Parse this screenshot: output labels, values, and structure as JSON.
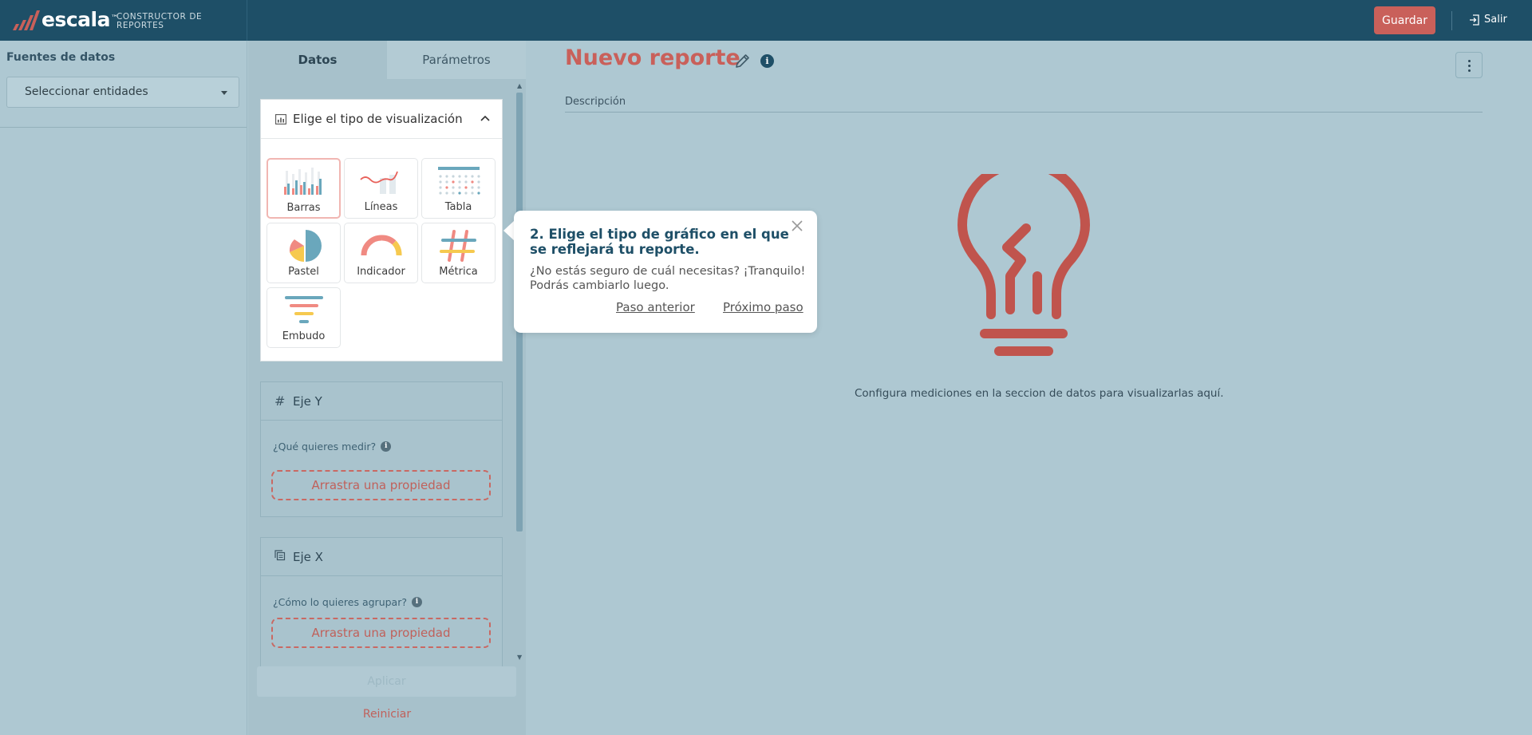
{
  "app": {
    "brand": "escala",
    "trademark": "™",
    "subtitle": "CONSTRUCTOR DE REPORTES",
    "save_label": "Guardar",
    "exit_label": "Salir"
  },
  "sources": {
    "title": "Fuentes de datos",
    "select_value": "Seleccionar entidades"
  },
  "config": {
    "tabs": [
      {
        "label": "Datos",
        "active": true
      },
      {
        "label": "Parámetros",
        "active": false
      }
    ],
    "viz": {
      "title": "Elige el tipo de visualización",
      "types": [
        {
          "label": "Barras",
          "icon": "bar-chart-icon",
          "selected": true
        },
        {
          "label": "Líneas",
          "icon": "line-chart-icon",
          "selected": false
        },
        {
          "label": "Tabla",
          "icon": "table-icon",
          "selected": false
        },
        {
          "label": "Pastel",
          "icon": "pie-chart-icon",
          "selected": false
        },
        {
          "label": "Indicador",
          "icon": "gauge-icon",
          "selected": false
        },
        {
          "label": "Métrica",
          "icon": "hash-icon",
          "selected": false
        },
        {
          "label": "Embudo",
          "icon": "funnel-icon",
          "selected": false
        }
      ]
    },
    "y_axis": {
      "title": "Eje Y",
      "question": "¿Qué quieres medir?",
      "drop_label": "Arrastra una propiedad"
    },
    "x_axis": {
      "title": "Eje X",
      "question": "¿Cómo lo quieres agrupar?",
      "drop_label": "Arrastra una propiedad"
    },
    "apply_label": "Aplicar",
    "reset_label": "Reiniciar"
  },
  "report": {
    "title": "Nuevo reporte",
    "description_label": "Descripción",
    "empty_message": "Configura mediciones en la seccion de datos para visualizarlas aquí."
  },
  "tour": {
    "title": "2. Elige el tipo de gráfico en el que se reflejará tu reporte.",
    "body": "¿No estás seguro de cuál necesitas? ¡Tranquilo! Podrás cambiarlo luego.",
    "prev_label": "Paso anterior",
    "next_label": "Próximo paso"
  },
  "colors": {
    "topbar": "#1e4f67",
    "accent": "#c9605a",
    "overlay_bg": "#aec8d2"
  }
}
